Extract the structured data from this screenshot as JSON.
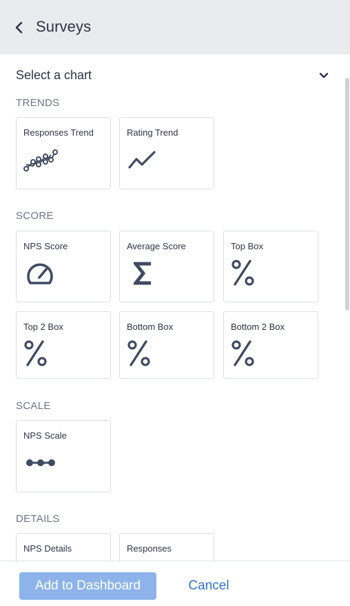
{
  "header": {
    "title": "Surveys",
    "back_icon": "chevron-left-icon"
  },
  "selector": {
    "label": "Select a chart",
    "icon": "chevron-down-icon"
  },
  "sections": {
    "trends": {
      "title": "TRENDS",
      "items": [
        {
          "label": "Responses Trend",
          "icon": "scatter-line-icon"
        },
        {
          "label": "Rating Trend",
          "icon": "trend-line-icon"
        }
      ]
    },
    "score": {
      "title": "SCORE",
      "items": [
        {
          "label": "NPS Score",
          "icon": "gauge-icon"
        },
        {
          "label": "Average Score",
          "icon": "sigma-icon"
        },
        {
          "label": "Top Box",
          "icon": "percent-icon"
        },
        {
          "label": "Top 2 Box",
          "icon": "percent-icon"
        },
        {
          "label": "Bottom Box",
          "icon": "percent-icon"
        },
        {
          "label": "Bottom 2 Box",
          "icon": "percent-icon"
        }
      ]
    },
    "scale": {
      "title": "SCALE",
      "items": [
        {
          "label": "NPS Scale",
          "icon": "dot-scale-icon"
        }
      ]
    },
    "details": {
      "title": "DETAILS",
      "items": [
        {
          "label": "NPS Details"
        },
        {
          "label": "Responses"
        }
      ]
    }
  },
  "footer": {
    "add_label": "Add to Dashboard",
    "cancel_label": "Cancel"
  },
  "colors": {
    "header_bg": "#e9ebee",
    "icon": "#3e4a61",
    "section_title": "#6b7587",
    "primary_button": "#8db3ea",
    "link": "#2f72d0"
  }
}
